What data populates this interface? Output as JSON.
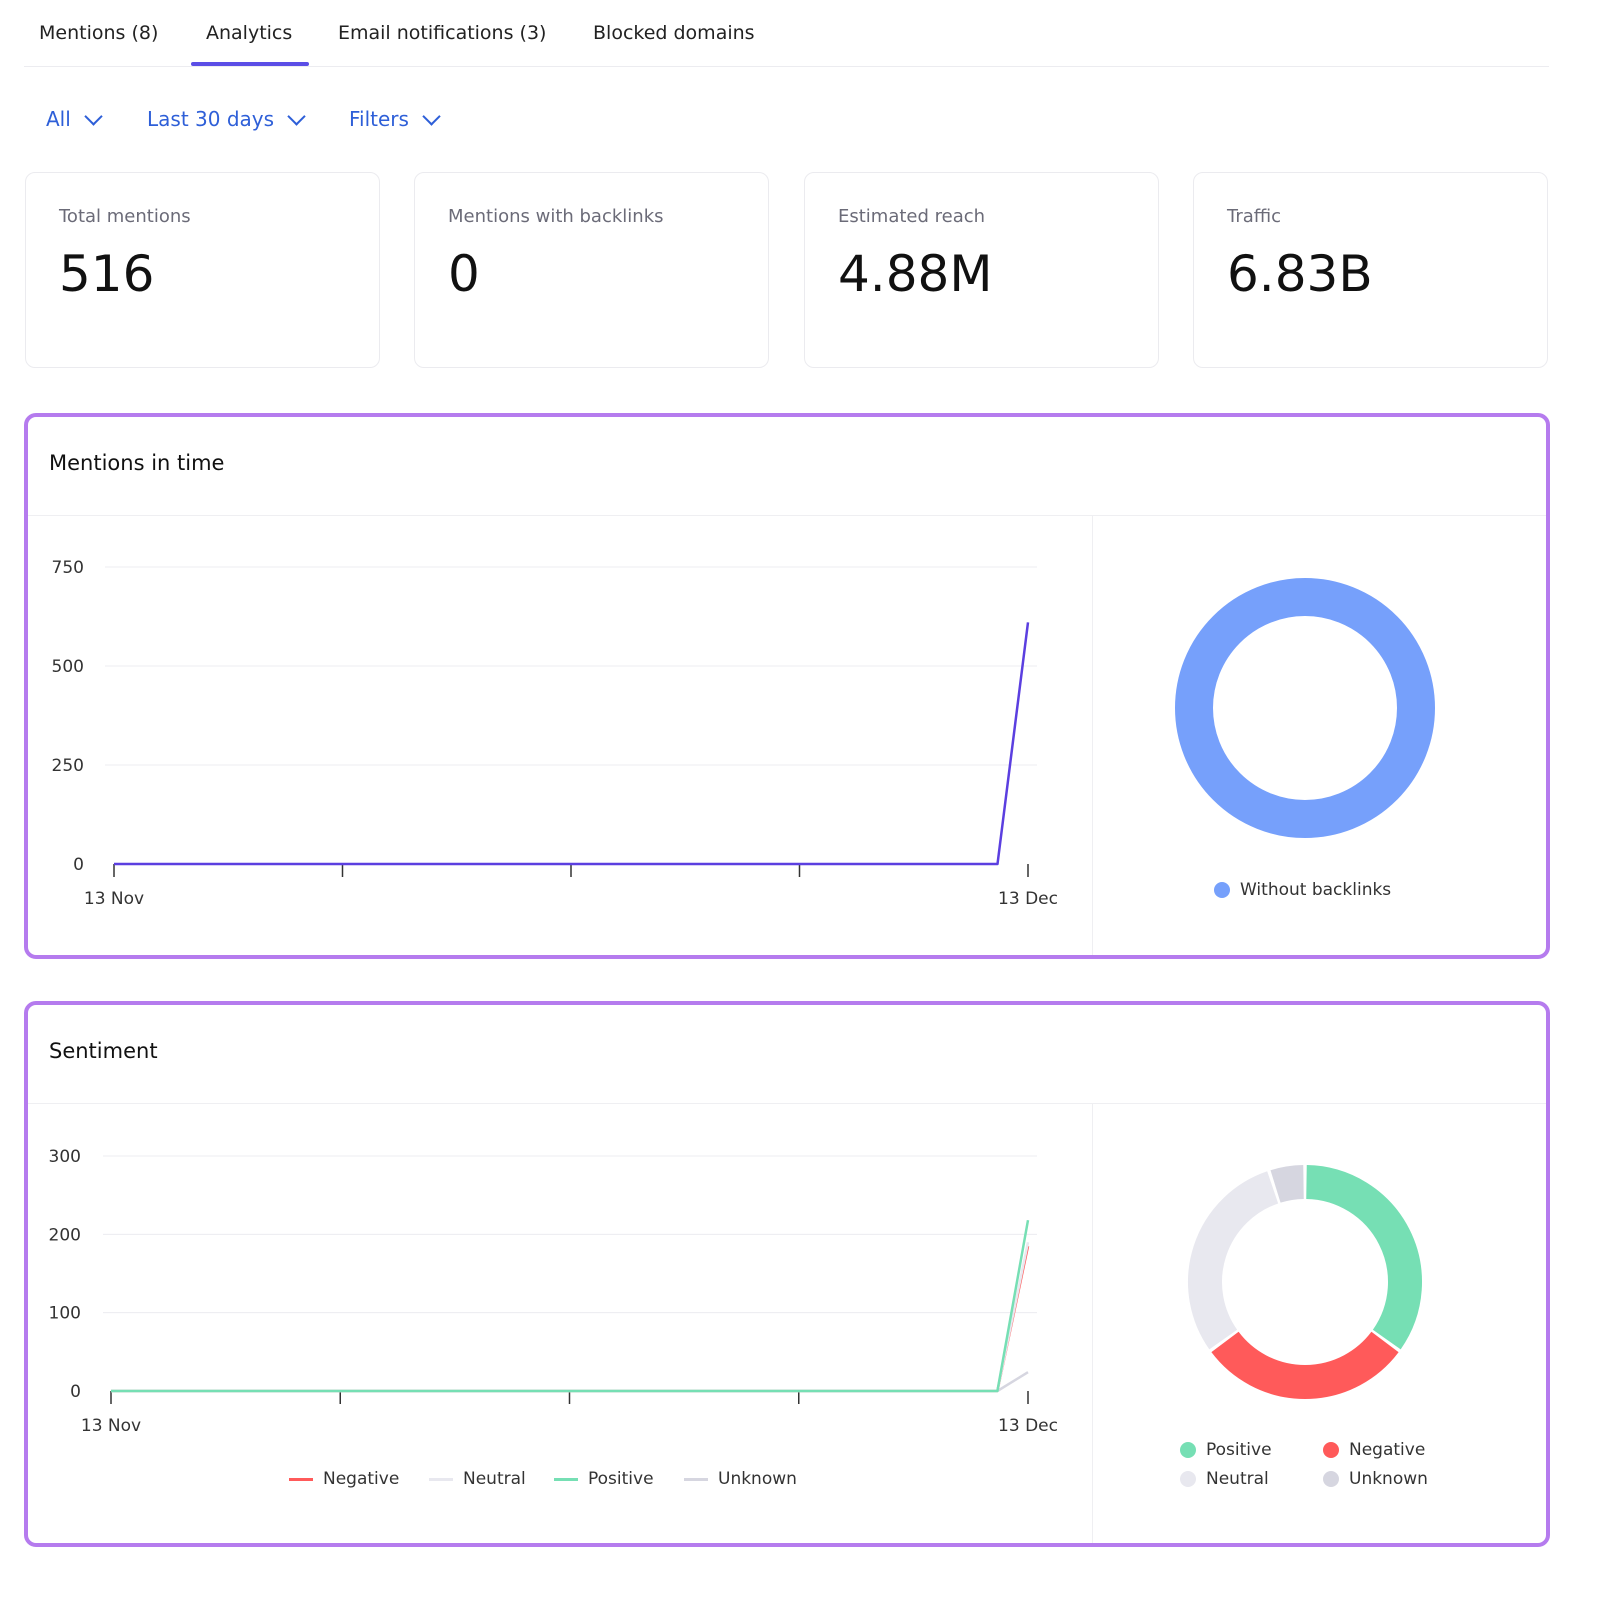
{
  "tabs": [
    {
      "label": "Mentions (8)"
    },
    {
      "label": "Analytics",
      "active": true
    },
    {
      "label": "Email notifications (3)"
    },
    {
      "label": "Blocked domains"
    }
  ],
  "filters": {
    "all": "All",
    "period": "Last 30 days",
    "filters": "Filters"
  },
  "stats": [
    {
      "label": "Total mentions",
      "value": "516"
    },
    {
      "label": "Mentions with backlinks",
      "value": "0"
    },
    {
      "label": "Estimated reach",
      "value": "4.88M"
    },
    {
      "label": "Traffic",
      "value": "6.83B"
    }
  ],
  "colors": {
    "accent": "#5b4ee6",
    "link": "#2e5fd8",
    "panel_border": "#b57bee"
  },
  "chart_data": [
    {
      "type": "line",
      "title": "Mentions in time",
      "x_labels": [
        "13 Nov",
        "13 Dec"
      ],
      "x_ticks": 5,
      "yticks": [
        0,
        250,
        500,
        750
      ],
      "ylim": [
        0,
        750
      ],
      "grid": true,
      "series": [
        {
          "color": "#5b3fe0",
          "values": [
            0,
            0,
            0,
            0,
            0,
            0,
            0,
            0,
            0,
            0,
            0,
            0,
            0,
            0,
            0,
            0,
            0,
            0,
            0,
            0,
            0,
            0,
            0,
            0,
            0,
            0,
            0,
            0,
            0,
            0,
            610
          ]
        }
      ]
    },
    {
      "type": "pie",
      "donut": true,
      "slices": [
        {
          "name": "Without backlinks",
          "value": 516,
          "color": "#76a0fb"
        }
      ],
      "legend": "bottom"
    },
    {
      "type": "line",
      "title": "Sentiment",
      "x_labels": [
        "13 Nov",
        "13 Dec"
      ],
      "x_ticks": 5,
      "yticks": [
        0,
        100,
        200,
        300
      ],
      "ylim": [
        0,
        300
      ],
      "grid": true,
      "legend": "bottom",
      "series": [
        {
          "name": "Negative",
          "color": "#ff5a5a",
          "last": 185
        },
        {
          "name": "Neutral",
          "color": "#e8e8ef",
          "last": 190
        },
        {
          "name": "Unknown",
          "color": "#d6d6e0",
          "last": 24
        },
        {
          "name": "Positive",
          "color": "#76dfb4",
          "last": 218
        }
      ]
    },
    {
      "type": "pie",
      "donut": true,
      "legend": "bottom",
      "slices": [
        {
          "name": "Positive",
          "value": 35,
          "color": "#76dfb4"
        },
        {
          "name": "Negative",
          "value": 30,
          "color": "#ff5a5a"
        },
        {
          "name": "Neutral",
          "value": 30,
          "color": "#e8e8ef"
        },
        {
          "name": "Unknown",
          "value": 5,
          "color": "#d6d6e0"
        }
      ]
    }
  ]
}
